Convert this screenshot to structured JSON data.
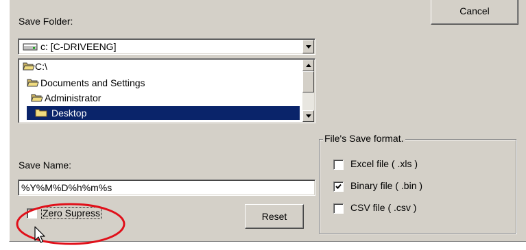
{
  "cancel_button": "Cancel",
  "save_folder": {
    "label": "Save Folder:",
    "drive_value": "c: [C-DRIVEENG]",
    "tree": [
      {
        "label": "C:\\",
        "open": true,
        "selected": false
      },
      {
        "label": "Documents and Settings",
        "open": true,
        "selected": false
      },
      {
        "label": "Administrator",
        "open": true,
        "selected": false
      },
      {
        "label": "Desktop",
        "open": false,
        "selected": true
      }
    ]
  },
  "save_name": {
    "label": "Save Name:",
    "value": "%Y%M%D%h%m%s"
  },
  "zero_suppress": {
    "label": "Zero Supress",
    "checked": false
  },
  "reset_button": "Reset",
  "file_format": {
    "title": "File's Save format.",
    "options": [
      {
        "label": "Excel file  ( .xls )",
        "checked": false
      },
      {
        "label": "Binary file ( .bin )",
        "checked": true
      },
      {
        "label": "CSV file ( .csv )",
        "checked": false
      }
    ]
  },
  "colors": {
    "face": "#d4d0c8",
    "selection": "#0a246a",
    "highlight_circle": "#e0101a"
  }
}
